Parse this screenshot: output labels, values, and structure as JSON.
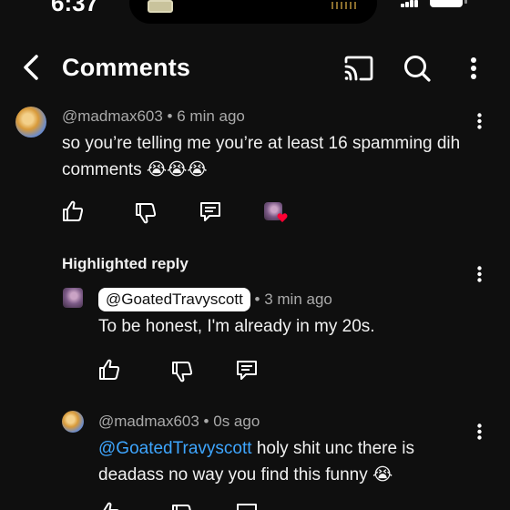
{
  "status_bar": {
    "time": "6:37"
  },
  "header": {
    "title": "Comments"
  },
  "comments": [
    {
      "author": "@madmax603",
      "time": "6 min ago",
      "text": "so you’re telling me you’re at least 16 spamming dih comments 😭😭😭"
    }
  ],
  "highlighted_label": "Highlighted reply",
  "replies": [
    {
      "author": "@GoatedTravyscott",
      "time": "3 min ago",
      "text": "To be honest, I'm already in my 20s."
    },
    {
      "author": "@madmax603",
      "time": "0s ago",
      "mention": "@GoatedTravyscott",
      "text": " holy shit unc there is deadass no way you find this funny 😭"
    }
  ],
  "colors": {
    "background": "#0f0f0f",
    "link": "#3ea6ff",
    "heart": "#ff0033"
  },
  "icons": [
    "back-icon",
    "cast-icon",
    "search-icon",
    "more-vert-icon",
    "like-icon",
    "dislike-icon",
    "reply-icon",
    "heart-icon"
  ]
}
